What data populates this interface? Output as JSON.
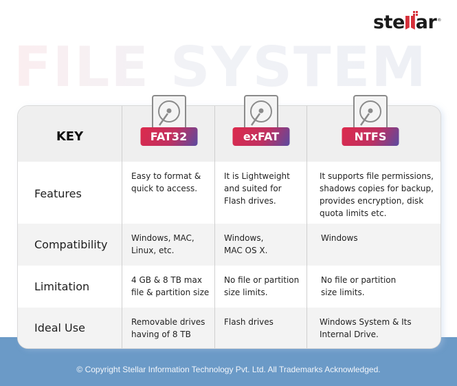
{
  "brand": {
    "logo_text_left": "ste",
    "logo_text_right": "ar",
    "accent": "#d6303a"
  },
  "watermark": "FILE SYSTEM",
  "table": {
    "key_header": "KEY",
    "columns": [
      "FAT32",
      "exFAT",
      "NTFS"
    ],
    "column_icon": "hard-disk-icon",
    "badge_gradient": [
      "#dc2a4c",
      "#5a4aa0"
    ],
    "rows": [
      {
        "label": "Features",
        "values": [
          "Easy to format &\nquick to access.",
          "It is Lightweight\nand suited for\nFlash drives.",
          "It supports file permissions,\nshadows copies for backup,\nprovides encryption, disk\nquota limits etc."
        ]
      },
      {
        "label": "Compatibility",
        "values": [
          "Windows, MAC,\nLinux, etc.",
          "Windows,\nMAC OS X.",
          "Windows"
        ]
      },
      {
        "label": "Limitation",
        "values": [
          "4 GB & 8 TB max\nfile & partition size",
          "No file or partition\nsize limits.",
          "No file or partition\nsize limits."
        ]
      },
      {
        "label": "Ideal Use",
        "values": [
          "Removable drives\nhaving of 8 TB",
          "Flash drives",
          "Windows System & Its\nInternal Drive."
        ]
      }
    ]
  },
  "footer": {
    "copyright": "© Copyright Stellar Information Technology Pvt. Ltd. All Trademarks Acknowledged.",
    "band_color": "#6b9ac7"
  }
}
